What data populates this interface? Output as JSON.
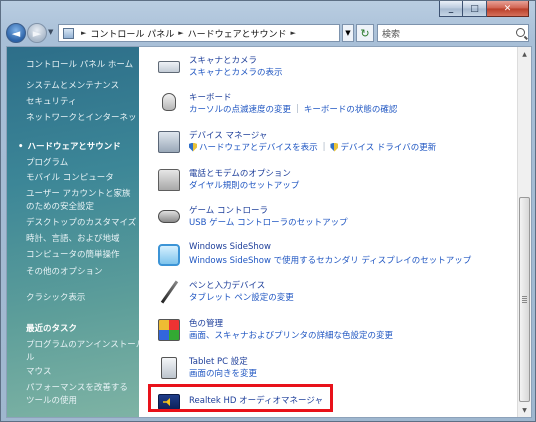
{
  "window": {
    "minimize_glyph": "_",
    "maximize_glyph": "□",
    "close_glyph": "✕"
  },
  "nav": {
    "back_glyph": "◄",
    "forward_glyph": "►",
    "breadcrumb": [
      "コントロール パネル",
      "ハードウェアとサウンド"
    ],
    "search_placeholder": "検索"
  },
  "sidebar": {
    "home": "コントロール パネル ホーム",
    "categories": [
      "システムとメンテナンス",
      "セキュリティ",
      "ネットワークとインターネット",
      "ハードウェアとサウンド",
      "プログラム",
      "モバイル コンピュータ",
      "ユーザー アカウントと家族",
      "のための安全設定",
      "デスクトップのカスタマイズ",
      "時計、言語、および地域",
      "コンピュータの簡単操作",
      "その他のオプション"
    ],
    "classic_view": "クラシック表示",
    "recent_tasks_heading": "最近のタスク",
    "recent_tasks": [
      "プログラムのアンインストール",
      "ル",
      "マウス",
      "パフォーマンスを改善する",
      "ツールの使用"
    ]
  },
  "items": [
    {
      "title": "スキャナとカメラ",
      "tasks": [
        "スキャナとカメラの表示"
      ],
      "icon": "scanner-icon"
    },
    {
      "title": "キーボード",
      "tasks": [
        "カーソルの点滅速度の変更",
        "キーボードの状態の確認"
      ],
      "icon": "keyboard-icon"
    },
    {
      "title": "デバイス マネージャ",
      "tasks": [
        "ハードウェアとデバイスを表示",
        "デバイス ドライバの更新"
      ],
      "icon": "device-manager-icon"
    },
    {
      "title": "電話とモデムのオプション",
      "tasks": [
        "ダイヤル規則のセットアップ"
      ],
      "icon": "phone-icon"
    },
    {
      "title": "ゲーム コントローラ",
      "tasks": [
        "USB ゲーム コントローラのセットアップ"
      ],
      "icon": "gamepad-icon"
    },
    {
      "title": "Windows SideShow",
      "tasks": [
        "Windows SideShow で使用するセカンダリ ディスプレイのセットアップ"
      ],
      "icon": "sideshow-icon"
    },
    {
      "title": "ペンと入力デバイス",
      "tasks": [
        "タブレット ペン設定の変更"
      ],
      "icon": "pen-icon"
    },
    {
      "title": "色の管理",
      "tasks": [
        "画面、スキャナおよびプリンタの詳細な色設定の変更"
      ],
      "icon": "color-management-icon"
    },
    {
      "title": "Tablet PC 設定",
      "tasks": [
        "画面の向きを変更"
      ],
      "icon": "tablet-icon"
    },
    {
      "title": "Realtek HD オーディオマネージャ",
      "tasks": [],
      "icon": "realtek-audio-icon"
    }
  ],
  "scrollbar": {
    "up_glyph": "▲",
    "down_glyph": "▼"
  }
}
